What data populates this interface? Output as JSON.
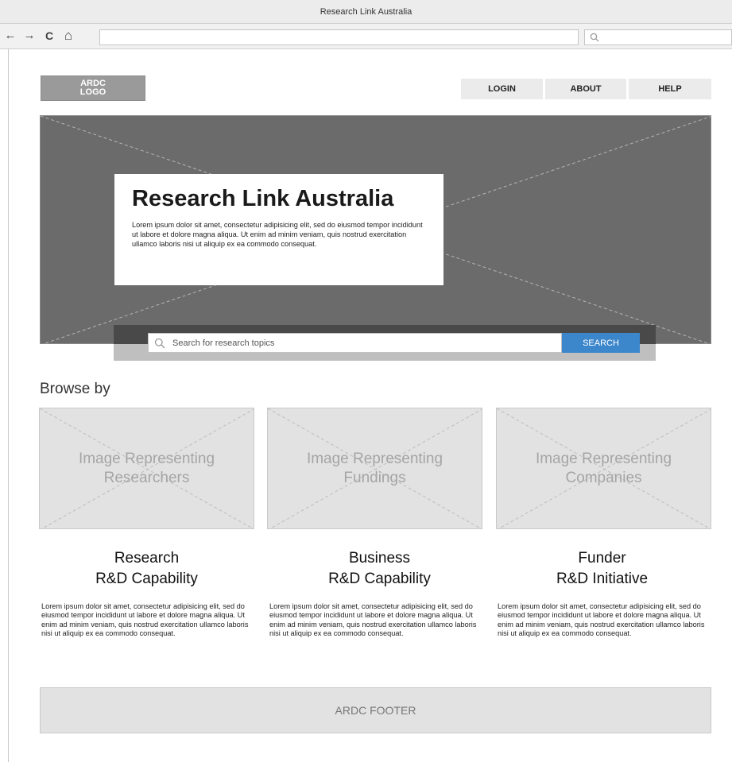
{
  "window": {
    "title": "Research Link Australia"
  },
  "browser": {
    "back_icon": "←",
    "forward_icon": "→",
    "reload_icon": "C",
    "home_icon": "⌂",
    "url": "",
    "search_placeholder": ""
  },
  "header": {
    "logo_line1": "ARDC",
    "logo_line2": "LOGO",
    "nav": [
      "LOGIN",
      "ABOUT",
      "HELP"
    ]
  },
  "hero": {
    "title": "Research Link Australia",
    "body": "Lorem ipsum dolor sit amet, consectetur adipisicing elit, sed do eiusmod tempor incididunt ut labore et dolore magna aliqua. Ut enim ad minim veniam, quis nostrud exercitation ullamco laboris nisi ut aliquip ex ea commodo consequat."
  },
  "search": {
    "placeholder": "Search for research topics",
    "button_label": "SEARCH",
    "button_color": "#3c86cc"
  },
  "browse": {
    "heading": "Browse by",
    "cards": [
      {
        "image_line1": "Image Representing",
        "image_line2": "Researchers",
        "title_line1": "Research",
        "title_line2": "R&D Capability",
        "body": "Lorem ipsum dolor sit amet, consectetur adipisicing elit, sed do eiusmod tempor incididunt ut labore et dolore magna aliqua. Ut enim ad minim veniam, quis nostrud exercitation ullamco laboris nisi ut aliquip ex ea commodo consequat."
      },
      {
        "image_line1": "Image Representing",
        "image_line2": "Fundings",
        "title_line1": "Business",
        "title_line2": "R&D Capability",
        "body": "Lorem ipsum dolor sit amet, consectetur adipisicing elit, sed do eiusmod tempor incididunt ut labore et dolore magna aliqua. Ut enim ad minim veniam, quis nostrud exercitation ullamco laboris nisi ut aliquip ex ea commodo consequat."
      },
      {
        "image_line1": "Image Representing",
        "image_line2": "Companies",
        "title_line1": "Funder",
        "title_line2": "R&D Initiative",
        "body": "Lorem ipsum dolor sit amet, consectetur adipisicing elit, sed do eiusmod tempor incididunt ut labore et dolore magna aliqua. Ut enim ad minim veniam, quis nostrud exercitation ullamco laboris nisi ut aliquip ex ea commodo consequat."
      }
    ]
  },
  "footer": {
    "label": "ARDC FOOTER"
  }
}
